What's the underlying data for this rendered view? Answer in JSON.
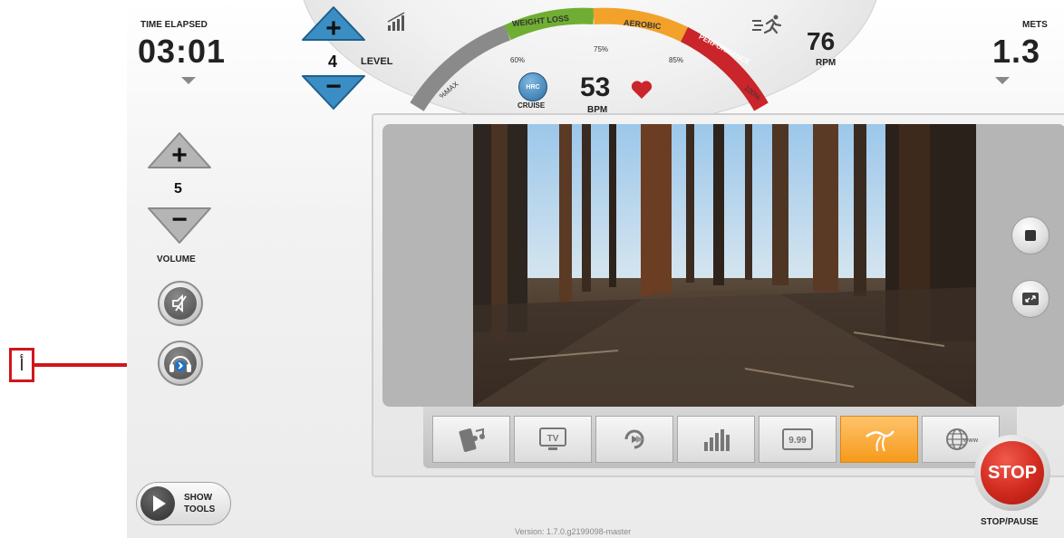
{
  "time": {
    "label": "TIME ELAPSED",
    "value": "03:01"
  },
  "mets": {
    "label": "METS",
    "value": "1.3"
  },
  "level": {
    "value": "4",
    "label": "LEVEL"
  },
  "rpm": {
    "value": "76",
    "label": "RPM"
  },
  "heart": {
    "value": "53",
    "label": "BPM",
    "cruise_label": "CRUISE",
    "hrc_label": "HRC"
  },
  "zones": {
    "weight_loss": "WEIGHT LOSS",
    "aerobic": "AEROBIC",
    "performance": "PERFORMANCE",
    "p_max": "%MAX",
    "p60": "60%",
    "p75": "75%",
    "p85": "85%",
    "p100": "100%"
  },
  "volume": {
    "value": "5",
    "label": "VOLUME"
  },
  "tools": {
    "line1": "SHOW",
    "line2": "TOOLS"
  },
  "stop": {
    "label": "STOP",
    "caption": "STOP/PAUSE"
  },
  "version": "Version: 1.7.0.g2199098-master",
  "annotation": {
    "marker": "أ"
  },
  "tabs": [
    {
      "icon": "music-phone-icon"
    },
    {
      "icon": "tv-icon",
      "text": "TV"
    },
    {
      "icon": "replay-icon"
    },
    {
      "icon": "stats-bars-icon"
    },
    {
      "icon": "price-999-icon",
      "text": "9.99"
    },
    {
      "icon": "virtual-road-icon",
      "active": true
    },
    {
      "icon": "www-globe-icon",
      "text": "www"
    }
  ],
  "colors": {
    "zone_gray": "#8a8a8a",
    "zone_green": "#6fae33",
    "zone_orange": "#f2a22a",
    "zone_red": "#c9252a",
    "level_blue": "#3a8ec4",
    "stop_red": "#d22a1f",
    "annotation_red": "#d0161c",
    "tab_active": "#f59a1b"
  }
}
